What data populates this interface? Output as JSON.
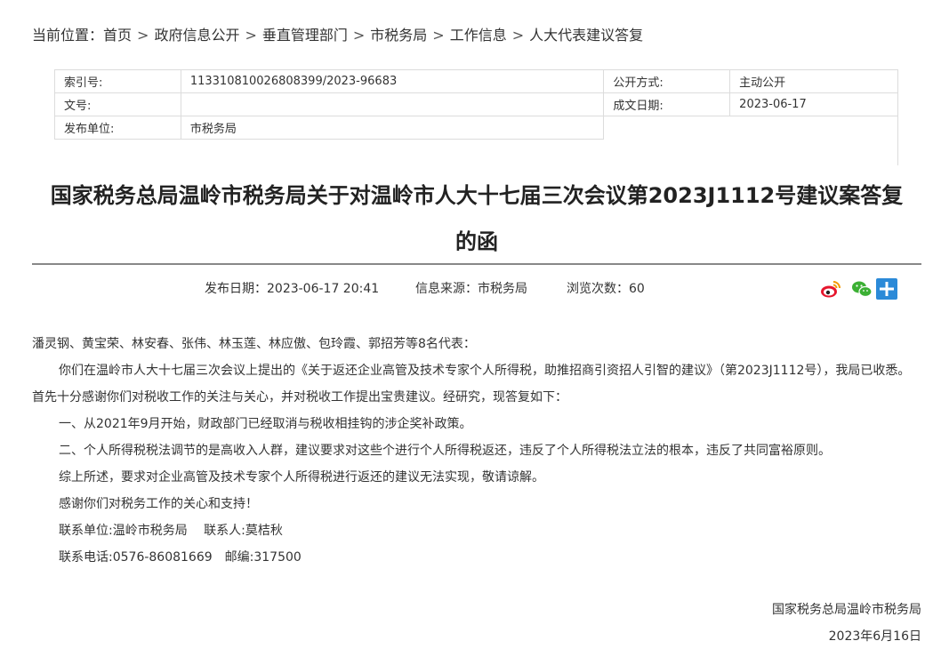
{
  "breadcrumb": {
    "prefix": "当前位置：",
    "items": [
      "首页",
      "政府信息公开",
      "垂直管理部门",
      "市税务局",
      "工作信息",
      "人大代表建议答复"
    ],
    "separator": ">"
  },
  "meta": {
    "index_label": "索引号:",
    "index_value": "113310810026808399/2023-96683",
    "open_method_label": "公开方式:",
    "open_method_value": "主动公开",
    "doc_no_label": "文号:",
    "doc_no_value": "",
    "date_label": "成文日期:",
    "date_value": "2023-06-17",
    "issuer_label": "发布单位:",
    "issuer_value": "市税务局"
  },
  "article": {
    "title_line1": "国家税务总局温岭市税务局关于对温岭市人大十七届三次会议第2023J1112号建议案答复",
    "title_line2": "的函",
    "publish_date": "发布日期：2023-06-17 20:41",
    "source": "信息来源：市税务局",
    "views": "浏览次数：60"
  },
  "share_icons": [
    "weibo-icon",
    "wechat-icon",
    "add-share-icon"
  ],
  "body": {
    "salutation": "潘灵钢、黄宝荣、林安春、张伟、林玉莲、林应傲、包玲霞、郭招芳等8名代表：",
    "p1": "你们在温岭市人大十七届三次会议上提出的《关于返还企业高管及技术专家个人所得税，助推招商引资招人引智的建议》（第2023J1112号），我局已收悉。首先十分感谢你们对税收工作的关注与关心，并对税收工作提出宝贵建议。经研究，现答复如下：",
    "p2": "一、从2021年9月开始，财政部门已经取消与税收相挂钩的涉企奖补政策。",
    "p3": "二、个人所得税税法调节的是高收入人群，建议要求对这些个进行个人所得税返还，违反了个人所得税法立法的根本，违反了共同富裕原则。",
    "p4": "综上所述，要求对企业高管及技术专家个人所得税进行返还的建议无法实现，敬请谅解。",
    "p5": "感谢你们对税务工作的关心和支持！",
    "p6": "联系单位:温岭市税务局　 联系人:莫桔秋",
    "p7": "联系电话:0576-86081669　邮编:317500"
  },
  "signature": {
    "org": "国家税务总局温岭市税务局",
    "date": "2023年6月16日"
  },
  "colors": {
    "weibo_red": "#e6162d",
    "wechat_green": "#3cb034",
    "add_blue": "#2b8ad8"
  }
}
